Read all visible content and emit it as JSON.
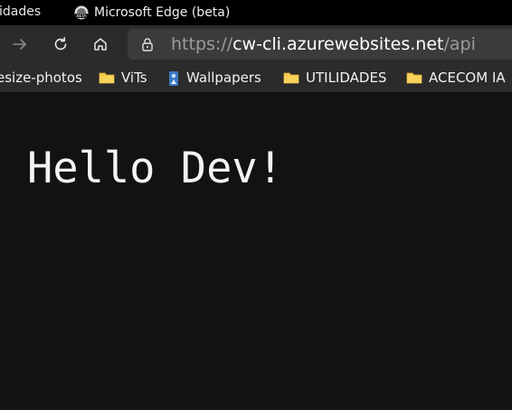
{
  "os_panel": {
    "left_text": "idades",
    "app_title": "Microsoft Edge (beta)",
    "app_icon": "edge-beta-icon"
  },
  "nav": {
    "forward_icon": "arrow-right-icon",
    "reload_icon": "reload-icon",
    "home_icon": "home-icon",
    "lock_icon": "lock-icon",
    "url_scheme": "https://",
    "url_host": "cw-cli.azurewebsites.net",
    "url_path": "/api"
  },
  "bookmarks": [
    {
      "label": "esize-photos",
      "icon": "none"
    },
    {
      "label": "ViTs",
      "icon": "folder-icon"
    },
    {
      "label": "Wallpapers",
      "icon": "wallpaper-icon"
    },
    {
      "label": "UTILIDADES",
      "icon": "folder-icon"
    },
    {
      "label": "ACECOM IA",
      "icon": "folder-icon"
    }
  ],
  "page": {
    "heading": "Hello Dev!"
  },
  "colors": {
    "page_background": "#121212",
    "toolbar_background": "#2b2b2b",
    "address_background": "#3b3b3b",
    "folder_color": "#f4c84c"
  }
}
